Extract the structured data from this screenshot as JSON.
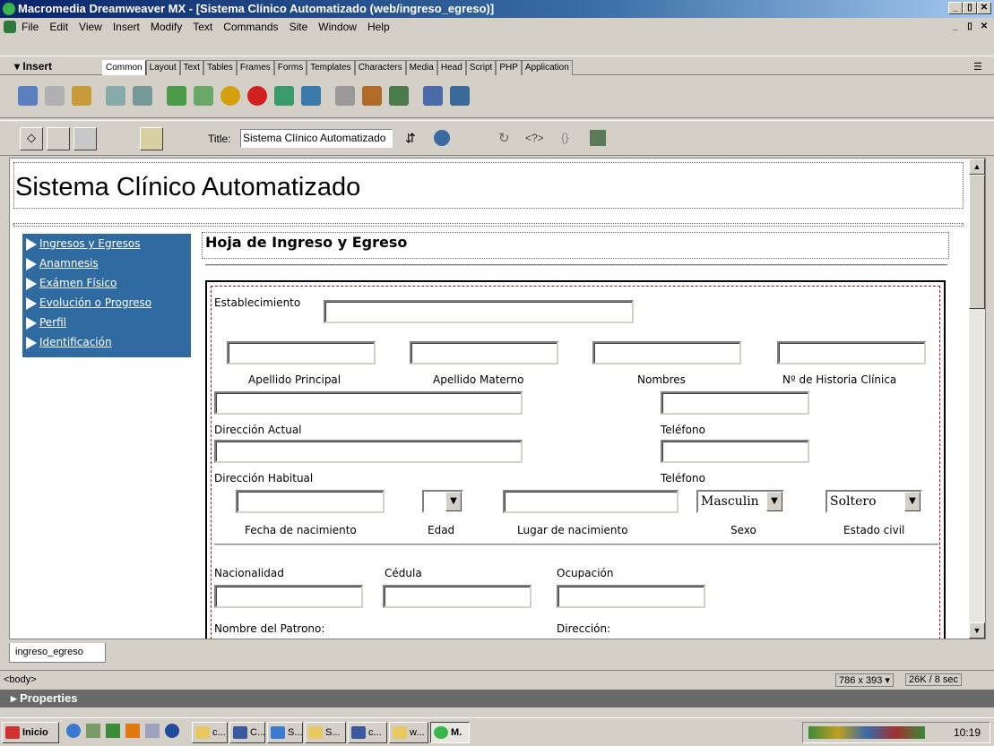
{
  "window": {
    "title": "Macromedia Dreamweaver MX - [Sistema Clínico Automatizado (web/ingreso_egreso)]"
  },
  "menu": [
    "File",
    "Edit",
    "View",
    "Insert",
    "Modify",
    "Text",
    "Commands",
    "Site",
    "Window",
    "Help"
  ],
  "insert_panel": {
    "title": "Insert",
    "tabs": [
      "Common",
      "Layout",
      "Text",
      "Tables",
      "Frames",
      "Forms",
      "Templates",
      "Characters",
      "Media",
      "Head",
      "Script",
      "PHP",
      "Application"
    ],
    "active_tab": "Common"
  },
  "document_toolbar": {
    "title_label": "Title:",
    "title_value": "Sistema Clínico Automatizado"
  },
  "page": {
    "heading": "Sistema Clínico Automatizado",
    "nav": [
      "Ingresos y Egresos",
      "Anamnesis",
      "Exámen Físico",
      "Evolución o Progreso",
      "Perfil",
      "Identificación"
    ],
    "section_title": "Hoja de Ingreso y Egreso",
    "form": {
      "establecimiento": "Establecimiento",
      "apellido_principal": "Apellido Principal",
      "apellido_materno": "Apellido Materno",
      "nombres": "Nombres",
      "historia": "Nº de Historia Clínica",
      "direccion_actual": "Dirección Actual",
      "telefono1": "Teléfono",
      "direccion_habitual": "Dirección Habitual",
      "telefono2": "Teléfono",
      "sexo_value": "Masculin",
      "estado_value": "Soltero",
      "fecha": "Fecha de nacimiento",
      "edad": "Edad",
      "lugar": "Lugar de nacimiento",
      "sexo": "Sexo",
      "estado": "Estado civil",
      "nacionalidad": "Nacionalidad",
      "cedula": "Cédula",
      "ocupacion": "Ocupación",
      "patrono": "Nombre del Patrono:",
      "direccion": "Dirección:"
    }
  },
  "doc_tab": "ingreso_egreso",
  "status": {
    "tag": "<body>",
    "size": "786 x 393",
    "download": "26K / 8 sec"
  },
  "properties_label": "Properties",
  "taskbar": {
    "start": "Inicio",
    "buttons": [
      "c...",
      "C...",
      "S...",
      "S...",
      "c...",
      "w...",
      "M."
    ],
    "clock": "10:19"
  }
}
